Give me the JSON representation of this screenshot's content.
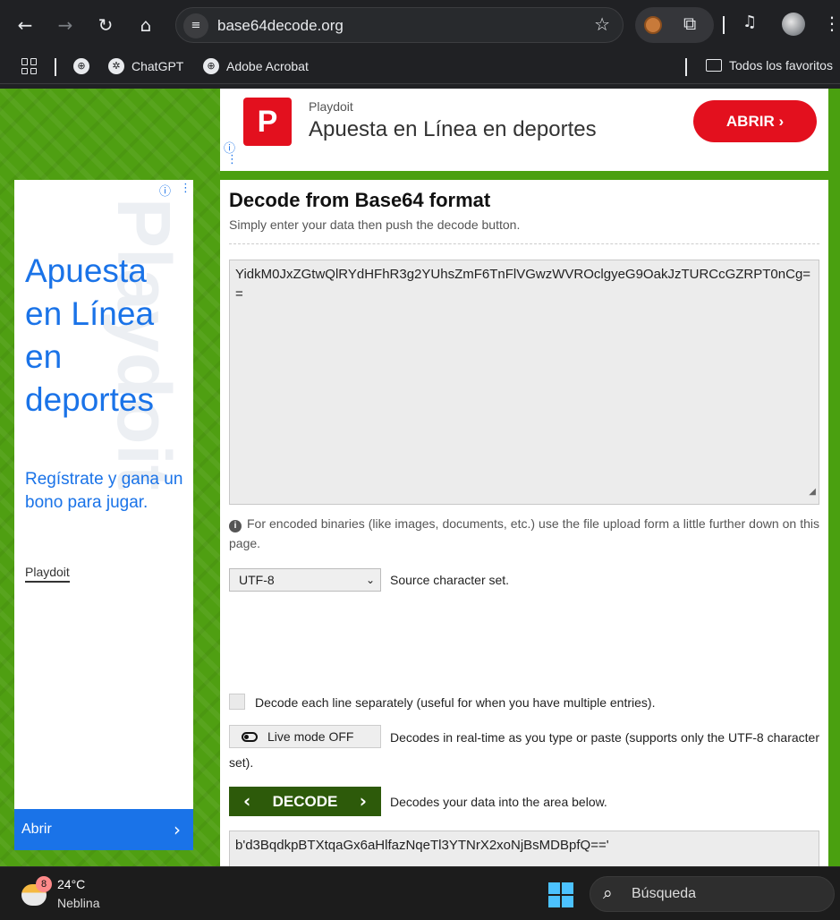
{
  "browser": {
    "url": "base64decode.org",
    "nav": {
      "back": "←",
      "forward": "→",
      "reload": "↻",
      "home": "⌂"
    },
    "icons": [
      "tune-icon",
      "star-icon",
      "cookie-icon",
      "puzzle-icon",
      "media-icon",
      "profile-avatar",
      "kebab-menu-icon"
    ]
  },
  "bookmarks": {
    "items": [
      {
        "label": "ChatGPT",
        "icon": "chatgpt-icon"
      },
      {
        "label": "Adobe Acrobat",
        "icon": "acrobat-icon"
      }
    ],
    "all_bookmarks": "Todos los favoritos"
  },
  "top_ad": {
    "logo_letter": "P",
    "brand": "Playdoit",
    "headline": "Apuesta en Línea en deportes",
    "cta": "ABRIR ›"
  },
  "side_ad": {
    "watermark": "Playdoit",
    "headline": "Apuesta en Línea en deportes",
    "sub": "Regístrate y gana un bono para jugar.",
    "brand": "Playdoit",
    "cta": "Abrir"
  },
  "main": {
    "title": "Decode from Base64 format",
    "subtitle": "Simply enter your data then push the decode button.",
    "input_value": "YidkM0JxZGtwQlRYdHFhR3g2YUhsZmF6TnFlVGwzWVROclgyeG9OakJzTURCcGZRPT0nCg==",
    "note": "For encoded binaries (like images, documents, etc.) use the file upload form a little further down on this page.",
    "charset": {
      "selected": "UTF-8",
      "label": "Source character set."
    },
    "per_line": {
      "label": "Decode each line separately (useful for when you have multiple entries)."
    },
    "live_mode": {
      "button": "Live mode OFF",
      "desc": "Decodes in real-time as you type or paste (supports only the UTF-8 character set)."
    },
    "decode": {
      "button": "DECODE",
      "desc": "Decodes your data into the area below."
    },
    "output_value": "b'd3BqdkpBTXtqaGx6aHlfazNqeTl3YTNrX2xoNjBsMDBpfQ=='"
  },
  "taskbar": {
    "weather_badge": "8",
    "temperature": "24°C",
    "condition": "Neblina",
    "search_placeholder": "Búsqueda"
  }
}
